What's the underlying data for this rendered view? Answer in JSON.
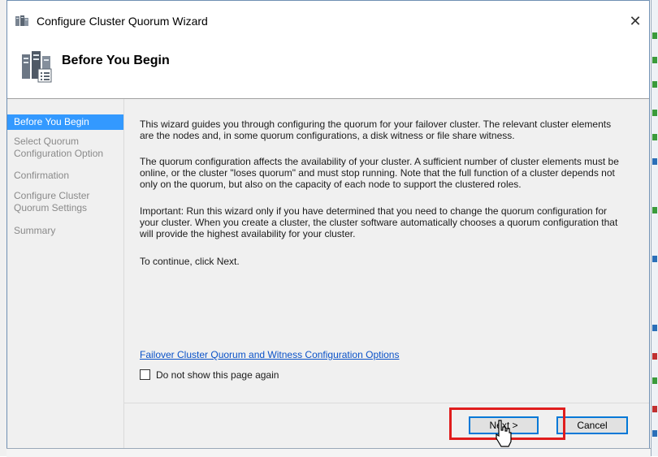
{
  "window": {
    "title": "Configure Cluster Quorum Wizard",
    "close_label": "✕"
  },
  "header": {
    "title": "Before You Begin"
  },
  "nav": {
    "items": [
      {
        "label": "Before You Begin",
        "active": true
      },
      {
        "label": "Select Quorum\nConfiguration Option",
        "active": false
      },
      {
        "label": "Confirmation",
        "active": false
      },
      {
        "label": "Configure Cluster\nQuorum Settings",
        "active": false
      },
      {
        "label": "Summary",
        "active": false
      }
    ]
  },
  "content": {
    "para1": "This wizard guides you through configuring the quorum for your failover cluster. The relevant cluster elements are the nodes and, in some quorum configurations, a disk witness or file share witness.",
    "para2": "The quorum configuration affects the availability of your cluster. A sufficient number of cluster elements must be online, or the cluster \"loses quorum\" and must stop running. Note that the full function of a cluster depends not only on the quorum, but also on the capacity of each node to support the clustered roles.",
    "para3": "Important: Run this wizard only if you have determined that you need to change the quorum configuration for your cluster. When you create a cluster, the cluster software automatically chooses a quorum configuration that will provide the highest availability for your cluster.",
    "para4": "To continue, click Next.",
    "link": "Failover Cluster Quorum and Witness Configuration Options",
    "checkbox_label": "Do not show this page again",
    "checkbox_checked": false
  },
  "buttons": {
    "next": "Next >",
    "cancel": "Cancel"
  },
  "colors": {
    "nav_active": "#3399ff",
    "link": "#0a52c8",
    "highlight": "#e01d1d",
    "focus_border": "#0078d7"
  }
}
